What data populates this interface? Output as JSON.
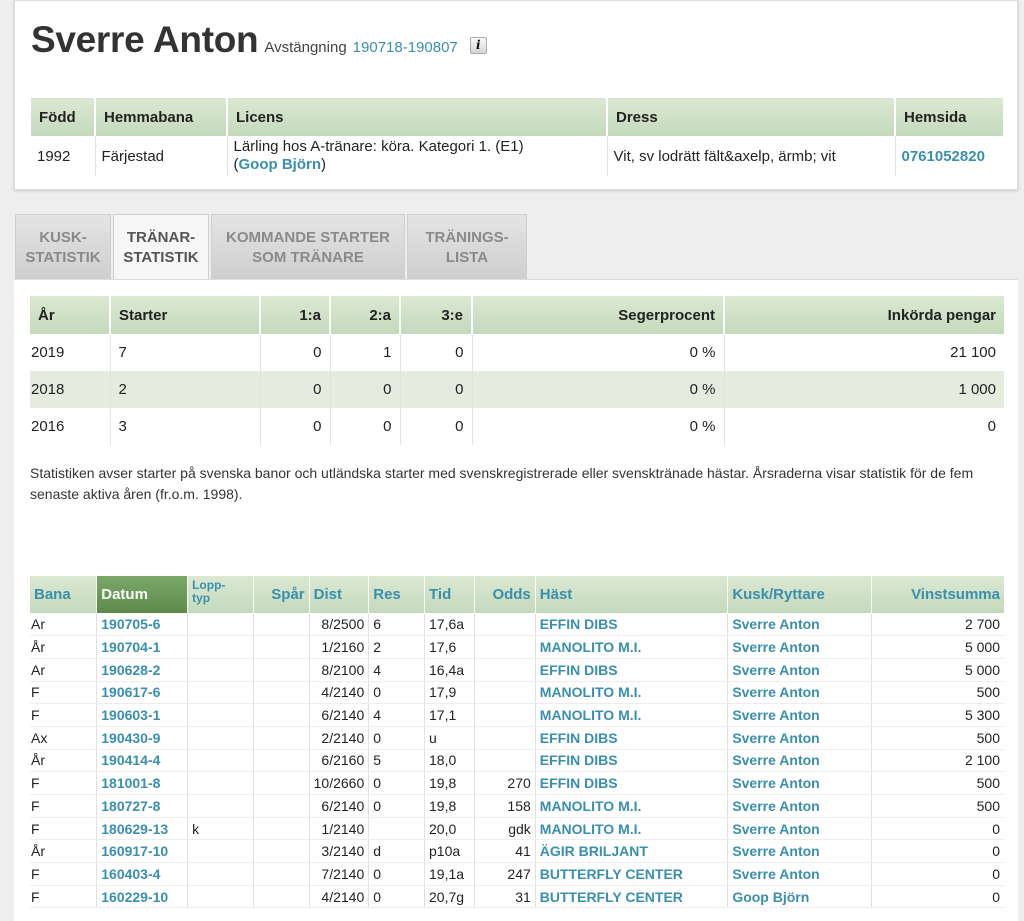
{
  "header": {
    "name": "Sverre Anton",
    "suspension_label": "Avstängning",
    "suspension_period": "190718-190807",
    "info_icon": "i"
  },
  "info_table": {
    "headers": [
      "Född",
      "Hemmabana",
      "Licens",
      "Dress",
      "Hemsida"
    ],
    "born": "1992",
    "home_track": "Färjestad",
    "license_text": "Lärling hos A-tränare: köra. Kategori 1. (E1)",
    "license_trainer": "Goop Björn",
    "dress": "Vit, sv lodrätt fält&axelp, ärmb; vit",
    "homepage": "0761052820"
  },
  "tabs": [
    {
      "line1": "KUSK-",
      "line2": "STATISTIK",
      "active": false
    },
    {
      "line1": "TRÄNAR-",
      "line2": "STATISTIK",
      "active": true
    },
    {
      "line1": "KOMMANDE STARTER",
      "line2": "SOM TRÄNARE",
      "active": false
    },
    {
      "line1": "TRÄNINGS-",
      "line2": "LISTA",
      "active": false
    }
  ],
  "year_table": {
    "headers": [
      "År",
      "Starter",
      "1:a",
      "2:a",
      "3:e",
      "Segerprocent",
      "Inkörda pengar"
    ],
    "rows": [
      [
        "2019",
        "7",
        "0",
        "1",
        "0",
        "0 %",
        "21 100"
      ],
      [
        "2018",
        "2",
        "0",
        "0",
        "0",
        "0 %",
        "1 000"
      ],
      [
        "2016",
        "3",
        "0",
        "0",
        "0",
        "0 %",
        "0"
      ]
    ]
  },
  "stats_note": "Statistiken avser starter på svenska banor och utländska starter med svenskregistrerade eller svensktränade hästar. Årsraderna visar statistik för de fem senaste aktiva åren (fr.o.m. 1998).",
  "starts_table": {
    "headers": {
      "bana": "Bana",
      "datum": "Datum",
      "lopptyp_1": "Lopp-",
      "lopptyp_2": "typ",
      "spar": "Spår",
      "dist": "Dist",
      "res": "Res",
      "tid": "Tid",
      "odds": "Odds",
      "hast": "Häst",
      "kusk": "Kusk/Ryttare",
      "vinst": "Vinstsumma"
    },
    "rows": [
      {
        "bana": "Ar",
        "datum": "190705-6",
        "typ": "",
        "spar": "",
        "dist": "8/2500",
        "res": "6",
        "tid": "17,6a",
        "odds": "",
        "hast": "EFFIN DIBS",
        "kusk": "Sverre Anton",
        "vinst": "2 700"
      },
      {
        "bana": "År",
        "datum": "190704-1",
        "typ": "",
        "spar": "",
        "dist": "1/2160",
        "res": "2",
        "tid": "17,6",
        "odds": "",
        "hast": "MANOLITO M.I.",
        "kusk": "Sverre Anton",
        "vinst": "5 000"
      },
      {
        "bana": "Ar",
        "datum": "190628-2",
        "typ": "",
        "spar": "",
        "dist": "8/2100",
        "res": "4",
        "tid": "16,4a",
        "odds": "",
        "hast": "EFFIN DIBS",
        "kusk": "Sverre Anton",
        "vinst": "5 000"
      },
      {
        "bana": "F",
        "datum": "190617-6",
        "typ": "",
        "spar": "",
        "dist": "4/2140",
        "res": "0",
        "tid": "17,9",
        "odds": "",
        "hast": "MANOLITO M.I.",
        "kusk": "Sverre Anton",
        "vinst": "500"
      },
      {
        "bana": "F",
        "datum": "190603-1",
        "typ": "",
        "spar": "",
        "dist": "6/2140",
        "res": "4",
        "tid": "17,1",
        "odds": "",
        "hast": "MANOLITO M.I.",
        "kusk": "Sverre Anton",
        "vinst": "5 300"
      },
      {
        "bana": "Ax",
        "datum": "190430-9",
        "typ": "",
        "spar": "",
        "dist": "2/2140",
        "res": "0",
        "tid": "u",
        "odds": "",
        "hast": "EFFIN DIBS",
        "kusk": "Sverre Anton",
        "vinst": "500"
      },
      {
        "bana": "År",
        "datum": "190414-4",
        "typ": "",
        "spar": "",
        "dist": "6/2160",
        "res": "5",
        "tid": "18,0",
        "odds": "",
        "hast": "EFFIN DIBS",
        "kusk": "Sverre Anton",
        "vinst": "2 100"
      },
      {
        "bana": "F",
        "datum": "181001-8",
        "typ": "",
        "spar": "",
        "dist": "10/2660",
        "res": "0",
        "tid": "19,8",
        "odds": "270",
        "hast": "EFFIN DIBS",
        "kusk": "Sverre Anton",
        "vinst": "500"
      },
      {
        "bana": "F",
        "datum": "180727-8",
        "typ": "",
        "spar": "",
        "dist": "6/2140",
        "res": "0",
        "tid": "19,8",
        "odds": "158",
        "hast": "MANOLITO M.I.",
        "kusk": "Sverre Anton",
        "vinst": "500"
      },
      {
        "bana": "F",
        "datum": "180629-13",
        "typ": "k",
        "spar": "",
        "dist": "1/2140",
        "res": "",
        "tid": "20,0",
        "odds": "gdk",
        "hast": "MANOLITO M.I.",
        "kusk": "Sverre Anton",
        "vinst": "0"
      },
      {
        "bana": "År",
        "datum": "160917-10",
        "typ": "",
        "spar": "",
        "dist": "3/2140",
        "res": "d",
        "tid": "p10a",
        "odds": "41",
        "hast": "ÄGIR BRILJANT",
        "kusk": "Sverre Anton",
        "vinst": "0"
      },
      {
        "bana": "F",
        "datum": "160403-4",
        "typ": "",
        "spar": "",
        "dist": "7/2140",
        "res": "0",
        "tid": "19,1a",
        "odds": "247",
        "hast": "BUTTERFLY CENTER",
        "kusk": "Sverre Anton",
        "vinst": "0"
      },
      {
        "bana": "F",
        "datum": "160229-10",
        "typ": "",
        "spar": "",
        "dist": "4/2140",
        "res": "0",
        "tid": "20,7g",
        "odds": "31",
        "hast": "BUTTERFLY CENTER",
        "kusk": "Goop Björn",
        "vinst": "0"
      }
    ]
  }
}
